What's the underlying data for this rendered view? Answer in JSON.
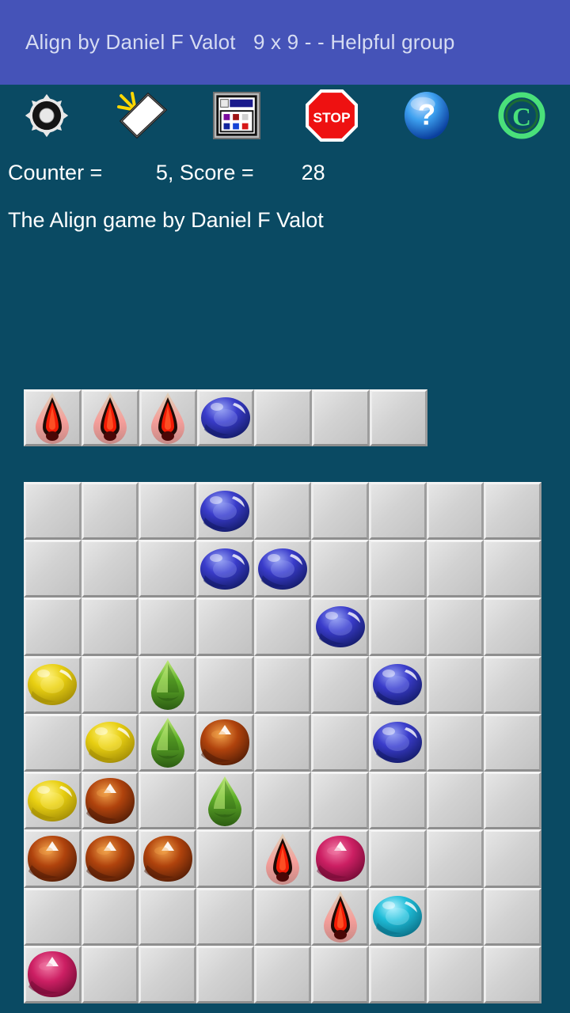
{
  "window": {
    "title": "Align by Daniel F Valot   9 x 9 - - Helpful group",
    "titlebar_color": "#4553b8",
    "background_color": "#0a4a63"
  },
  "toolbar": {
    "items": [
      {
        "icon": "gear-icon",
        "label": "Settings"
      },
      {
        "icon": "new-game-icon",
        "label": "New game"
      },
      {
        "icon": "scores-icon",
        "label": "Scores"
      },
      {
        "icon": "stop-icon",
        "label": "STOP"
      },
      {
        "icon": "help-icon",
        "label": "Help"
      },
      {
        "icon": "copyright-icon",
        "label": "Copyright"
      }
    ]
  },
  "status": {
    "counter_line": "Counter =         5, Score =        28",
    "counter_label": "Counter =",
    "counter_value": "5",
    "score_label": "Score =",
    "score_value": "28",
    "subtitle": "The Align game by Daniel F Valot"
  },
  "gem_colors": {
    "blue": "#3a3ccb",
    "yellow": "#e8cf12",
    "green": "#63b32b",
    "brown": "#b0430d",
    "red": "#f21b05",
    "pink": "#cc1f63",
    "cyan": "#1fbdd8"
  },
  "preview": {
    "columns": 7,
    "cells": [
      "red",
      "red",
      "red",
      "blue",
      null,
      null,
      null
    ]
  },
  "board": {
    "rows": 9,
    "columns": 9,
    "cells": [
      [
        null,
        null,
        null,
        "blue",
        null,
        null,
        null,
        null,
        null
      ],
      [
        null,
        null,
        null,
        "blue",
        "blue",
        null,
        null,
        null,
        null
      ],
      [
        null,
        null,
        null,
        null,
        null,
        "blue",
        null,
        null,
        null
      ],
      [
        "yellow",
        null,
        "green",
        null,
        null,
        null,
        "blue",
        null,
        null
      ],
      [
        null,
        "yellow",
        "green",
        "brown",
        null,
        null,
        "blue",
        null,
        null
      ],
      [
        "yellow",
        "brown",
        null,
        "green",
        null,
        null,
        null,
        null,
        null
      ],
      [
        "brown",
        "brown",
        "brown",
        null,
        "red",
        "pink",
        null,
        null,
        null
      ],
      [
        null,
        null,
        null,
        null,
        null,
        "red",
        "cyan",
        null,
        null
      ],
      [
        "pink",
        null,
        null,
        null,
        null,
        null,
        null,
        null,
        null
      ]
    ]
  }
}
